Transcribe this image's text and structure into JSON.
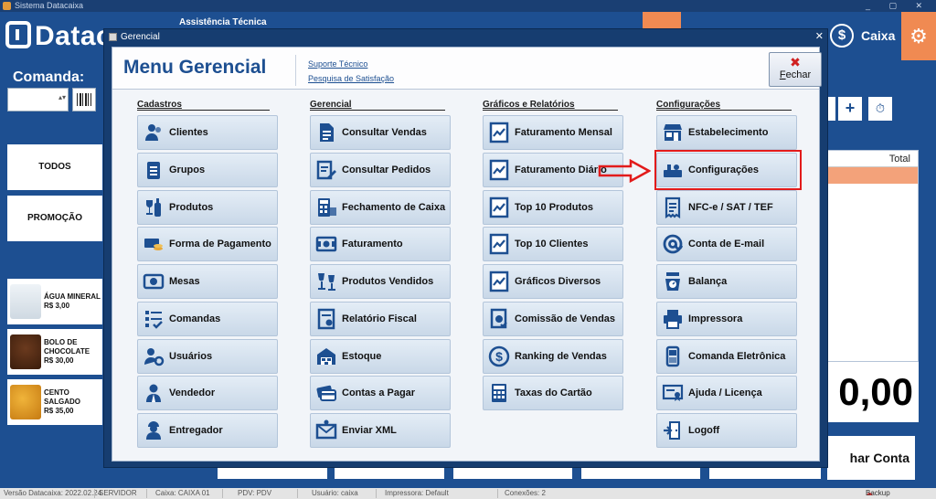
{
  "window": {
    "title": "Sistema Datacaixa",
    "controls": "_ ▢ ✕"
  },
  "brand": {
    "logo_text": "Datac"
  },
  "header": {
    "assist": "Assistência Técnica",
    "caixa_label": "Caixa"
  },
  "left": {
    "comanda_label": "Comanda:",
    "categories": [
      "TODOS",
      "PROMOÇÃO"
    ],
    "products": [
      {
        "name_1": "ÁGUA MINERAL",
        "name_2": "",
        "price": "R$ 3,00"
      },
      {
        "name_1": "BOLO DE",
        "name_2": "CHOCOLATE",
        "price": "R$ 30,00"
      },
      {
        "name_1": "CENTO",
        "name_2": "SALGADO",
        "price": "R$ 35,00"
      }
    ]
  },
  "right": {
    "table_header": "Total",
    "total_value": "0,00",
    "close_account": "har Conta"
  },
  "dialog": {
    "title": "Gerencial",
    "heading": "Menu Gerencial",
    "link_support": "Suporte Técnico",
    "link_survey": "Pesquisa de Satisfação",
    "close_button": {
      "icon": "✖",
      "first": "F",
      "rest": "echar"
    },
    "columns": [
      {
        "title": "Cadastros",
        "items": [
          {
            "label": "Clientes",
            "icon": "users-icon"
          },
          {
            "label": "Grupos",
            "icon": "clipboard-list-icon"
          },
          {
            "label": "Produtos",
            "icon": "wine-bottle-icon"
          },
          {
            "label": "Forma de Pagamento",
            "icon": "money-coins-icon"
          },
          {
            "label": "Mesas",
            "icon": "table-plate-icon"
          },
          {
            "label": "Comandas",
            "icon": "checklist-icon"
          },
          {
            "label": "Usuários",
            "icon": "user-gear-icon"
          },
          {
            "label": "Vendedor",
            "icon": "seller-icon"
          },
          {
            "label": "Entregador",
            "icon": "courier-icon"
          }
        ]
      },
      {
        "title": "Gerencial",
        "items": [
          {
            "label": "Consultar Vendas",
            "icon": "document-icon"
          },
          {
            "label": "Consultar Pedidos",
            "icon": "edit-document-icon"
          },
          {
            "label": "Fechamento de Caixa",
            "icon": "calculator-money-icon"
          },
          {
            "label": "Faturamento",
            "icon": "banknote-icon"
          },
          {
            "label": "Produtos Vendidos",
            "icon": "glasses-icon"
          },
          {
            "label": "Relatório Fiscal",
            "icon": "fiscal-report-icon"
          },
          {
            "label": "Estoque",
            "icon": "warehouse-icon"
          },
          {
            "label": "Contas a Pagar",
            "icon": "cards-icon"
          },
          {
            "label": "Enviar XML",
            "icon": "envelope-at-icon"
          }
        ]
      },
      {
        "title": "Gráficos e Relatórios",
        "items": [
          {
            "label": "Faturamento Mensal",
            "icon": "line-chart-icon"
          },
          {
            "label": "Faturamento Diário",
            "icon": "line-chart-icon"
          },
          {
            "label": "Top 10 Produtos",
            "icon": "line-chart-icon"
          },
          {
            "label": "Top 10 Clientes",
            "icon": "line-chart-icon"
          },
          {
            "label": "Gráficos Diversos",
            "icon": "line-chart-icon"
          },
          {
            "label": "Comissão de Vendas",
            "icon": "commission-icon"
          },
          {
            "label": "Ranking de Vendas",
            "icon": "dollar-circle-icon"
          },
          {
            "label": "Taxas do Cartão",
            "icon": "calculator-icon"
          }
        ]
      },
      {
        "title": "Configurações",
        "items": [
          {
            "label": "Estabelecimento",
            "icon": "store-icon"
          },
          {
            "label": "Configurações",
            "icon": "settings-tools-icon"
          },
          {
            "label": "NFC-e / SAT / TEF",
            "icon": "receipt-icon"
          },
          {
            "label": "Conta de E-mail",
            "icon": "at-sign-icon"
          },
          {
            "label": "Balança",
            "icon": "scale-icon"
          },
          {
            "label": "Impressora",
            "icon": "printer-icon"
          },
          {
            "label": "Comanda Eletrônica",
            "icon": "mobile-terminal-icon"
          },
          {
            "label": "Ajuda / Licença",
            "icon": "certificate-icon"
          },
          {
            "label": "Logoff",
            "icon": "logout-door-icon"
          }
        ]
      }
    ]
  },
  "status": {
    "version": "Versão Datacaixa: 2022.02.24",
    "server": "SERVIDOR",
    "caixa": "Caixa: CAIXA 01",
    "pdv": "PDV: PDV",
    "user": "Usuário: caixa",
    "printer": "Impressora: Default",
    "connections": "Conexões: 2",
    "backup": "Backup Nuvem"
  },
  "colors": {
    "primary": "#1d4f91",
    "accent": "#f08a52",
    "highlight": "#e21b1b"
  }
}
